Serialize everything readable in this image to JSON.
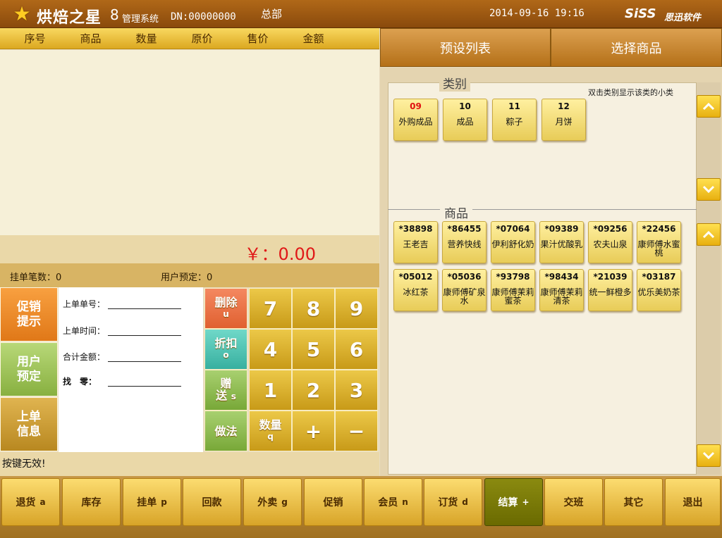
{
  "header": {
    "app_name": "烘焙之星",
    "version": "8",
    "subtitle": "管理系统",
    "dn": "DN:00000000",
    "branch": "总部",
    "datetime": "2014-09-16 19:16",
    "brand": "SiSS",
    "brand_sub": "思迅软件",
    "star_icon": "★"
  },
  "order_table": {
    "columns": [
      "序号",
      "商品",
      "数量",
      "原价",
      "售价",
      "金额"
    ],
    "rows": []
  },
  "total": "￥：0.00",
  "info": {
    "hang_count": "挂单笔数：0",
    "user_reserve": "用户预定：0"
  },
  "left_buttons": {
    "promo_line1": "促销",
    "promo_line2": "提示",
    "reserve_line1": "用户",
    "reserve_line2": "预定",
    "order_info_line1": "上单",
    "order_info_line2": "信息"
  },
  "form": {
    "order_no_label": "上单单号：",
    "order_no_value": "",
    "order_time_label": "上单时间：",
    "order_time_value": "",
    "total_amount_label": "合计金额：",
    "total_amount_value": "",
    "change_label": "找　零：",
    "change_value": ""
  },
  "keypad": {
    "del_label": "删除",
    "del_hot": "u",
    "disc_label": "折扣",
    "disc_hot": "o",
    "gift_label": "赠",
    "gift_label2": "送",
    "gift_hot": "s",
    "method_label": "做法",
    "qty_label": "数量",
    "qty_hot": "q",
    "digits": [
      "7",
      "8",
      "9",
      "4",
      "5",
      "6",
      "1",
      "2",
      "3"
    ],
    "plus": "+",
    "minus": "−"
  },
  "status": "按键无效!",
  "tabs": {
    "preset": "预设列表",
    "select": "选择商品"
  },
  "categories": {
    "title": "类别",
    "hint": "双击类别显示该类的小类",
    "items": [
      {
        "code": "09",
        "name": "外购成品",
        "highlight": true
      },
      {
        "code": "10",
        "name": "成品",
        "highlight": false
      },
      {
        "code": "11",
        "name": "粽子",
        "highlight": false
      },
      {
        "code": "12",
        "name": "月饼",
        "highlight": false
      }
    ]
  },
  "goods": {
    "title": "商品",
    "items": [
      {
        "code": "*38898",
        "name": "王老吉"
      },
      {
        "code": "*86455",
        "name": "营养快线"
      },
      {
        "code": "*07064",
        "name": "伊利舒化奶"
      },
      {
        "code": "*09389",
        "name": "果汁优酸乳"
      },
      {
        "code": "*09256",
        "name": "农夫山泉"
      },
      {
        "code": "*22456",
        "name": "康师傅水蜜桃"
      },
      {
        "code": "*05012",
        "name": "冰红茶"
      },
      {
        "code": "*05036",
        "name": "康师傅矿泉水"
      },
      {
        "code": "*93798",
        "name": "康师傅茉莉蜜茶"
      },
      {
        "code": "*98434",
        "name": "康师傅茉莉清茶"
      },
      {
        "code": "*21039",
        "name": "统一鲜橙多"
      },
      {
        "code": "*03187",
        "name": "优乐美奶茶"
      }
    ]
  },
  "toolbar": {
    "buttons": [
      {
        "label": "退货",
        "hot": "a"
      },
      {
        "label": "库存",
        "hot": ""
      },
      {
        "label": "挂单",
        "hot": "p"
      },
      {
        "label": "回款",
        "hot": ""
      },
      {
        "label": "外卖",
        "hot": "g"
      },
      {
        "label": "促销",
        "hot": ""
      },
      {
        "label": "会员",
        "hot": "n"
      },
      {
        "label": "订货",
        "hot": "d"
      },
      {
        "label": "结算",
        "hot": "+"
      },
      {
        "label": "交班",
        "hot": ""
      },
      {
        "label": "其它",
        "hot": ""
      },
      {
        "label": "退出",
        "hot": ""
      }
    ]
  }
}
